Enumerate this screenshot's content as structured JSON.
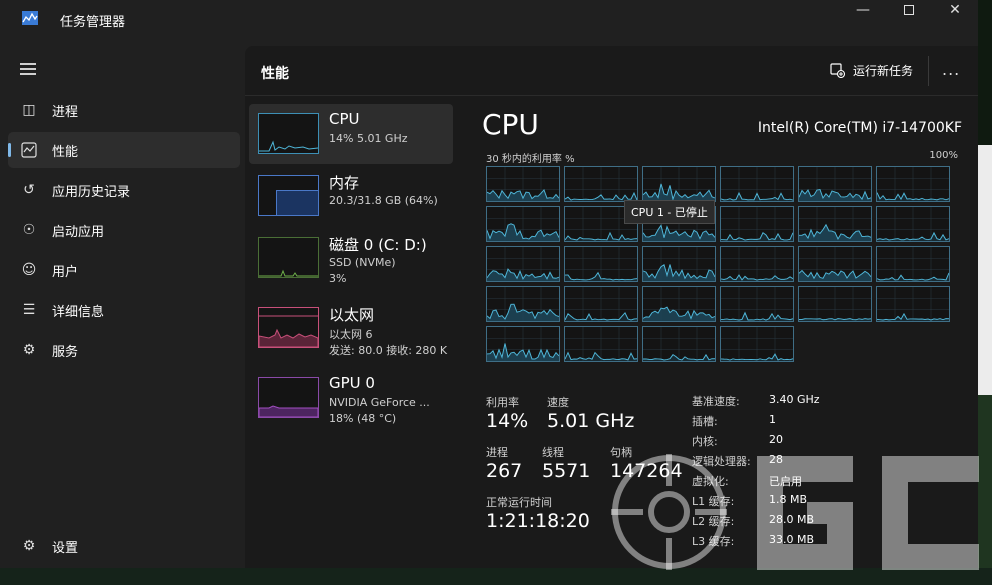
{
  "window": {
    "title": "任务管理器"
  },
  "nav": {
    "items": [
      {
        "label": "进程",
        "icon": "processes-icon"
      },
      {
        "label": "性能",
        "icon": "performance-icon",
        "active": true
      },
      {
        "label": "应用历史记录",
        "icon": "app-history-icon"
      },
      {
        "label": "启动应用",
        "icon": "startup-apps-icon"
      },
      {
        "label": "用户",
        "icon": "users-icon"
      },
      {
        "label": "详细信息",
        "icon": "details-icon"
      },
      {
        "label": "服务",
        "icon": "services-icon"
      }
    ],
    "settings_label": "设置"
  },
  "header": {
    "title": "性能",
    "new_task_label": "运行新任务",
    "more_label": "..."
  },
  "resources": [
    {
      "name": "CPU",
      "lines": [
        "14% 5.01 GHz"
      ],
      "color": "#3d8fb5"
    },
    {
      "name": "内存",
      "lines": [
        "20.3/31.8 GB (64%)"
      ],
      "color": "#4a78c8"
    },
    {
      "name": "磁盘 0 (C: D:)",
      "lines": [
        "SSD (NVMe)",
        "3%"
      ],
      "color": "#6fb14a"
    },
    {
      "name": "以太网",
      "lines": [
        "以太网 6",
        "发送: 80.0  接收: 280 K"
      ],
      "color": "#c8507a"
    },
    {
      "name": "GPU 0",
      "lines": [
        "NVIDIA GeForce ...",
        "18% (48 °C)"
      ],
      "color": "#a24fc2"
    }
  ],
  "detail": {
    "title": "CPU",
    "model": "Intel(R) Core(TM) i7-14700KF",
    "util_label": "30 秒内的利用率 %",
    "util_max": "100%",
    "tooltip": "CPU 1 - 已停止",
    "stats": {
      "utilization_label": "利用率",
      "utilization": "14%",
      "speed_label": "速度",
      "speed": "5.01 GHz",
      "processes_label": "进程",
      "processes": "267",
      "threads_label": "线程",
      "threads": "5571",
      "handles_label": "句柄",
      "handles": "147264",
      "uptime_label": "正常运行时间",
      "uptime": "1:21:18:20"
    },
    "specs": [
      {
        "key": "基准速度:",
        "value": "3.40 GHz"
      },
      {
        "key": "插槽:",
        "value": "1"
      },
      {
        "key": "内核:",
        "value": "20"
      },
      {
        "key": "逻辑处理器:",
        "value": "28"
      },
      {
        "key": "虚拟化:",
        "value": "已启用"
      },
      {
        "key": "L1 缓存:",
        "value": "1.8 MB"
      },
      {
        "key": "L2 缓存:",
        "value": "28.0 MB"
      },
      {
        "key": "L3 缓存:",
        "value": "33.0 MB"
      }
    ]
  },
  "colors": {
    "accent": "#7fb8e8",
    "cpu_line": "#4fb6d8",
    "cell_border": "#3f6e86"
  }
}
